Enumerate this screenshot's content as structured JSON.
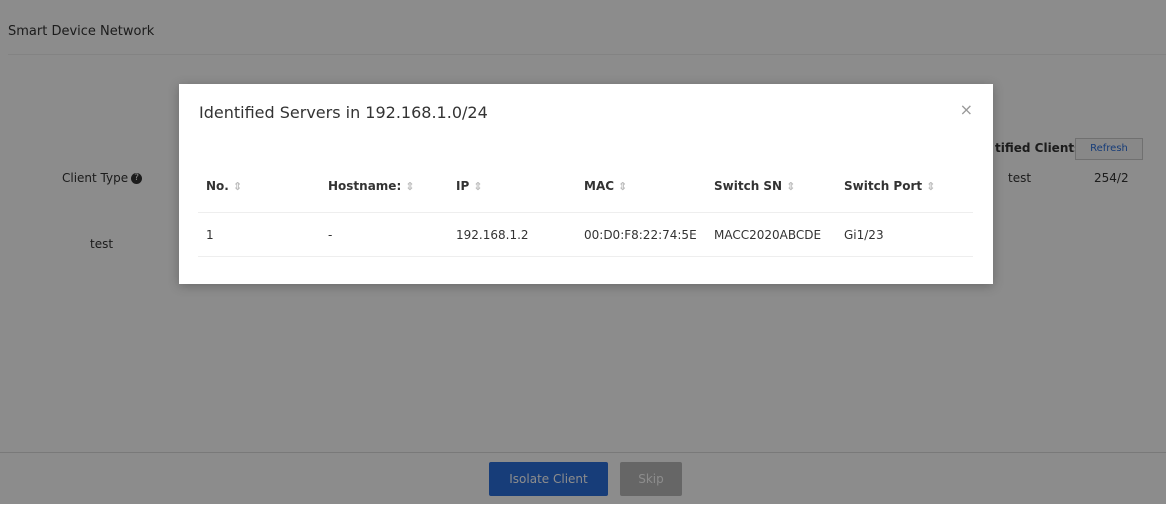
{
  "page": {
    "title": "Smart Device Network"
  },
  "background_table": {
    "client_type_header": "Client Type",
    "clients_header": "tified Clients",
    "refresh_label": "Refresh",
    "row_client_type": "test",
    "row_clients": "test",
    "row_count": "254/2"
  },
  "modal": {
    "title": "Identified Servers in 192.168.1.0/24",
    "close_glyph": "×",
    "columns": [
      "No.",
      "Hostname:",
      "IP",
      "MAC",
      "Switch SN",
      "Switch Port"
    ],
    "rows": [
      {
        "no": "1",
        "hostname": "-",
        "ip": "192.168.1.2",
        "mac": "00:D0:F8:22:74:5E",
        "switch_sn": "MACC2020ABCDE",
        "switch_port": "Gi1/23"
      }
    ]
  },
  "footer": {
    "isolate_label": "Isolate Client",
    "skip_label": "Skip"
  },
  "colors": {
    "primary": "#2b6fdc",
    "overlay": "rgba(0,0,0,0.45)"
  }
}
